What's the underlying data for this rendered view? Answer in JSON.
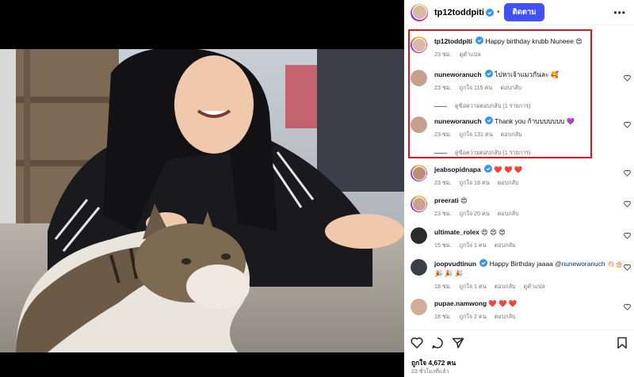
{
  "header": {
    "username": "tp12toddpiti",
    "dot": "•",
    "follow_label": "ติดตาม",
    "more": "•••"
  },
  "comments": [
    {
      "username": "tp12toddpiti",
      "text": "Happy birthday krubb Nuneee",
      "emoji": "😍",
      "meta": [
        "23 ชม.",
        "ดูคำแปล"
      ],
      "replies": ""
    },
    {
      "username": "nuneworanuch",
      "text": "ไปหาเจ้าแมวกันละ",
      "emoji": "🥰",
      "meta": [
        "23 ชม.",
        "ถูกใจ 115 คน",
        "ตอบกลับ"
      ],
      "replies": "ดูข้อความตอบกลับ (1 รายการ)"
    },
    {
      "username": "nuneworanuch",
      "text": "Thank you ก้าบบบบบบบ",
      "emoji": "💜",
      "meta": [
        "23 ชม.",
        "ถูกใจ 131 คน",
        "ตอบกลับ"
      ],
      "replies": "ดูข้อความตอบกลับ (1 รายการ)"
    },
    {
      "username": "jeabsopidnapa",
      "text": "",
      "emoji": "❤️ ❤️ ❤️",
      "meta": [
        "23 ชม.",
        "ถูกใจ 18 คน",
        "ตอบกลับ"
      ],
      "replies": ""
    },
    {
      "username": "preerati",
      "text": "",
      "emoji": "😍",
      "meta": [
        "23 ชม.",
        "ถูกใจ 20 คน",
        "ตอบกลับ"
      ],
      "replies": ""
    },
    {
      "username": "ultimate_rolex",
      "text": "",
      "emoji": "😍 😍 😍",
      "meta": [
        "15 ชม.",
        "ถูกใจ 1 คน",
        "ตอบกลับ"
      ],
      "replies": ""
    },
    {
      "username": "joopvudtinun",
      "text": "Happy Birthday jaaaa",
      "mention": "@nuneworanuch",
      "emoji": "👏🏻🎂",
      "emoji_line2": "🎉 🎉 🎉",
      "meta": [
        "18 ชม.",
        "ถูกใจ 1 คน",
        "ตอบกลับ",
        "ดูคำแปล"
      ],
      "replies": ""
    },
    {
      "username": "pupae.namwong",
      "text": "",
      "emoji": "❤️ ❤️ ❤️",
      "meta": [
        "18 ชม.",
        "ถูกใจ 2 คน",
        "ตอบกลับ"
      ],
      "replies": ""
    }
  ],
  "footer": {
    "likes": "ถูกใจ 4,672 คน",
    "time": "23 ชั่วโมงที่แล้ว"
  },
  "icons": {
    "like": "heart-icon",
    "comment": "comment-icon",
    "share": "share-icon",
    "save": "bookmark-icon",
    "verified": "verified-badge-icon"
  },
  "colors": {
    "accent": "#4150f7",
    "verified": "#3797f0",
    "highlight": "#e1141e",
    "meta": "#737373"
  }
}
